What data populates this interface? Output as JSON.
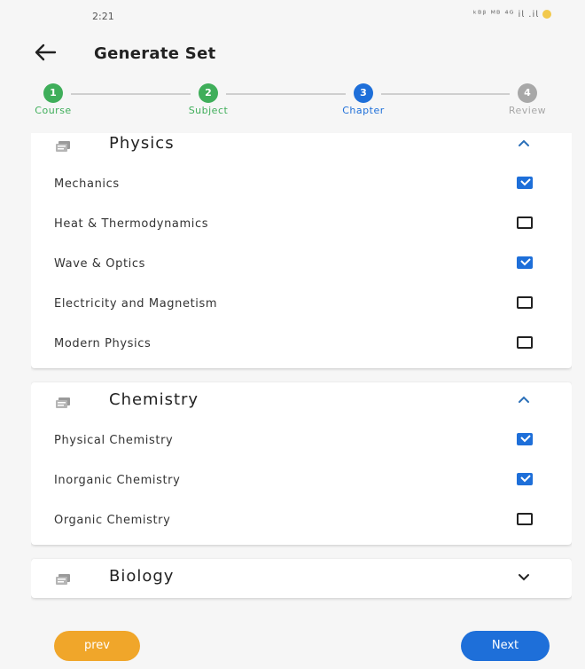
{
  "status_bar": {
    "time": "2:21",
    "icons": "ᵏᴮᵝ ᴹᴮ ⁴ᴳ 𝗂𝗅 .𝗂𝗅"
  },
  "app_bar": {
    "back_icon": "arrow-left-icon",
    "title": "Generate Set"
  },
  "stepper": {
    "steps": [
      {
        "number": "1",
        "label": "Course",
        "color": "#3fae5a",
        "state": "done"
      },
      {
        "number": "2",
        "label": "Subject",
        "color": "#3fae5a",
        "state": "done"
      },
      {
        "number": "3",
        "label": "Chapter",
        "color": "#1e6fd9",
        "state": "active"
      },
      {
        "number": "4",
        "label": "Review",
        "color": "#a8a8a8",
        "state": "pending"
      }
    ]
  },
  "subjects": [
    {
      "name": "Physics",
      "expanded": true,
      "chapters": [
        {
          "name": "Mechanics",
          "checked": true
        },
        {
          "name": "Heat & Thermodynamics",
          "checked": false
        },
        {
          "name": "Wave & Optics",
          "checked": true
        },
        {
          "name": "Electricity and Magnetism",
          "checked": false
        },
        {
          "name": "Modern Physics",
          "checked": false
        }
      ]
    },
    {
      "name": "Chemistry",
      "expanded": true,
      "chapters": [
        {
          "name": "Physical Chemistry",
          "checked": true
        },
        {
          "name": "Inorganic Chemistry",
          "checked": true
        },
        {
          "name": "Organic Chemistry",
          "checked": false
        }
      ]
    },
    {
      "name": "Biology",
      "expanded": false,
      "chapters": []
    }
  ],
  "buttons": {
    "prev": "prev",
    "next": "Next"
  },
  "colors": {
    "accent": "#1e6fd9",
    "done": "#3fae5a",
    "prev": "#f0a62a",
    "pending": "#a8a8a8"
  }
}
